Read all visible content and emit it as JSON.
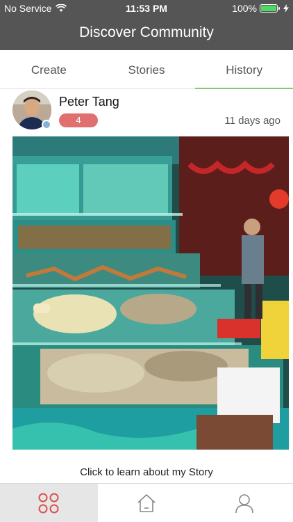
{
  "status_bar": {
    "carrier": "No Service",
    "time": "11:53 PM",
    "battery": "100%",
    "battery_level": 1.0
  },
  "nav": {
    "title": "Discover Community"
  },
  "tabs": [
    {
      "label": "Create",
      "active": false
    },
    {
      "label": "Stories",
      "active": false
    },
    {
      "label": "History",
      "active": true
    }
  ],
  "post": {
    "author": "Peter Tang",
    "count": "4",
    "time_ago": "11 days ago",
    "story_link": "Click to learn about my Story"
  },
  "bottom_bar": {
    "items": [
      {
        "icon": "grid-circles-icon",
        "active": true
      },
      {
        "icon": "home-icon",
        "active": false
      },
      {
        "icon": "profile-icon",
        "active": false
      }
    ]
  },
  "colors": {
    "header_bg": "#555555",
    "tab_underline": "#86c774",
    "badge_red": "#e07070",
    "bottom_accent": "#d9534f"
  }
}
